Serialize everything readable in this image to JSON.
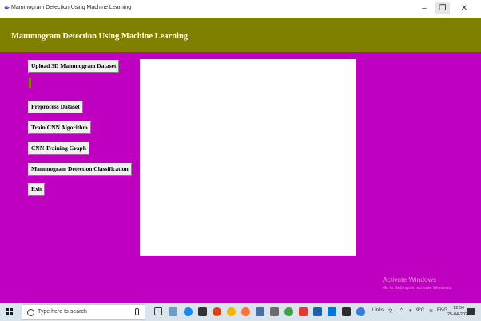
{
  "window": {
    "title": "Mammogram Detection Using Machine Learning",
    "controls": {
      "minimize": "–",
      "restore": "❐",
      "close": "✕"
    }
  },
  "header": {
    "title": "Mammogram Detection Using Machine Learning",
    "background": "#808000"
  },
  "main": {
    "background": "#c000c0",
    "buttons": [
      {
        "label": "Upload 3D Mammogram Dataset"
      },
      {
        "label": "Preprocess Dataset"
      },
      {
        "label": "Train CNN Algorithm"
      },
      {
        "label": "CNN Training Graph"
      },
      {
        "label": "Mammogram Detection Classification"
      },
      {
        "label": "Exit"
      }
    ],
    "path_label": ""
  },
  "watermark": {
    "line1": "Activate Windows",
    "line2": "Go to Settings to activate Windows."
  },
  "taskbar": {
    "search_placeholder": "Type here to search",
    "tray_links": "Links",
    "tray_temp": "9°C",
    "tray_lang": "ENG",
    "time": "12:54",
    "date": "25-04-2023"
  }
}
